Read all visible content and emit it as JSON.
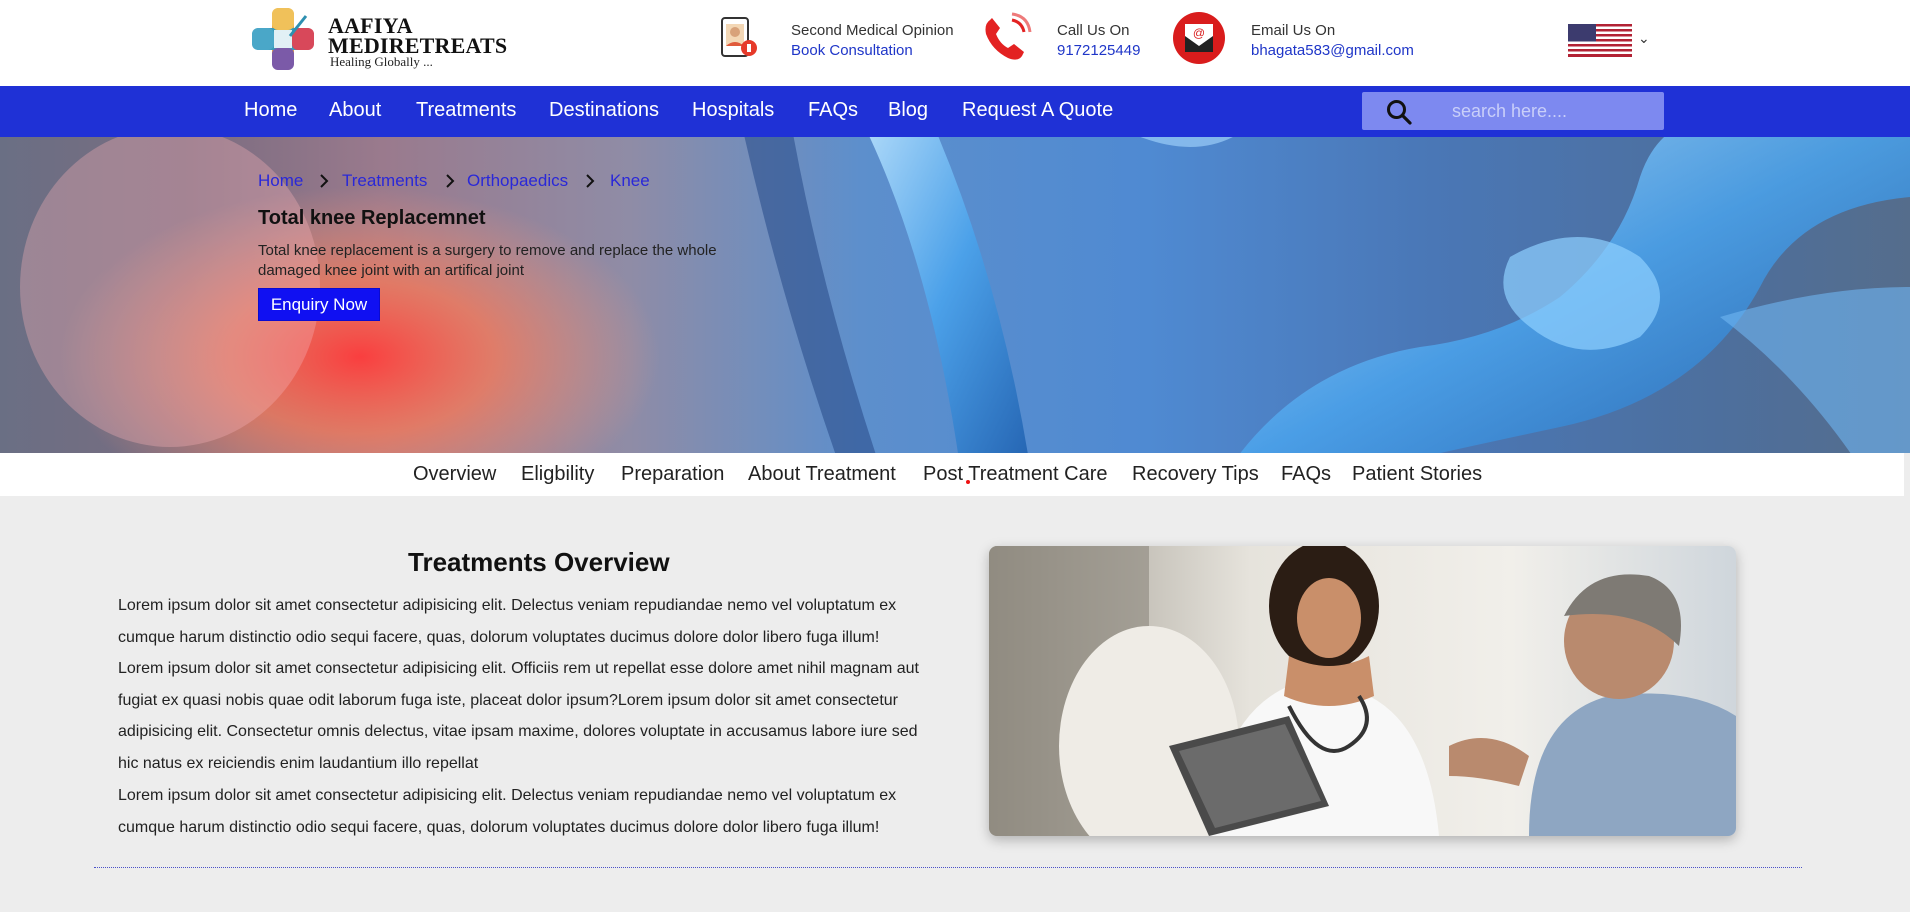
{
  "brand": {
    "name": "AAFIYA MEDIRETREATS",
    "tagline": "Healing Globally ..."
  },
  "header": {
    "opinion": {
      "label": "Second Medical Opinion",
      "value": "Book Consultation",
      "icon": "doctor-tablet-icon"
    },
    "call": {
      "label": "Call Us On",
      "value": "9172125449",
      "icon": "phone-icon"
    },
    "email": {
      "label": "Email Us On",
      "value": "bhagata583@gmail.com",
      "icon": "email-icon"
    },
    "language": {
      "icon": "us-flag-icon"
    }
  },
  "nav": {
    "items": [
      "Home",
      "About",
      "Treatments",
      "Destinations",
      "Hospitals",
      "FAQs",
      "Blog",
      "Request A Quote"
    ],
    "search_placeholder": "search here...."
  },
  "hero": {
    "breadcrumb": [
      "Home",
      "Treatments",
      "Orthopaedics",
      "Knee"
    ],
    "title": "Total knee Replacemnet",
    "description": "Total knee replacement is a surgery to remove and replace the whole damaged knee joint with an artifical joint",
    "button": "Enquiry Now"
  },
  "subtabs": [
    "Overview",
    "Eligbility",
    "Preparation",
    "About Treatment",
    "Post Treatment Care",
    "Recovery Tips",
    "FAQs",
    "Patient Stories"
  ],
  "overview": {
    "title": "Treatments Overview",
    "paragraphs": [
      "Lorem ipsum dolor sit amet consectetur adipisicing elit. Delectus veniam repudiandae nemo vel voluptatum ex cumque harum distinctio odio sequi facere, quas, dolorum voluptates ducimus dolore dolor libero fuga illum!",
      "Lorem ipsum dolor sit amet consectetur adipisicing elit. Officiis rem ut repellat esse dolore amet nihil magnam aut fugiat ex quasi nobis quae odit laborum fuga iste, placeat dolor ipsum?Lorem ipsum dolor sit amet consectetur adipisicing elit. Consectetur omnis delectus, vitae ipsam maxime, dolores voluptate in accusamus labore iure sed hic natus ex reiciendis enim laudantium illo repellat",
      "Lorem ipsum dolor sit amet consectetur adipisicing elit. Delectus veniam repudiandae nemo vel voluptatum ex cumque harum distinctio odio sequi facere, quas, dolorum voluptates ducimus dolore dolor libero fuga illum!"
    ]
  },
  "colors": {
    "nav": "#1f31d6",
    "link": "#1f36c8",
    "button": "#1010f2",
    "background": "#ededed"
  }
}
